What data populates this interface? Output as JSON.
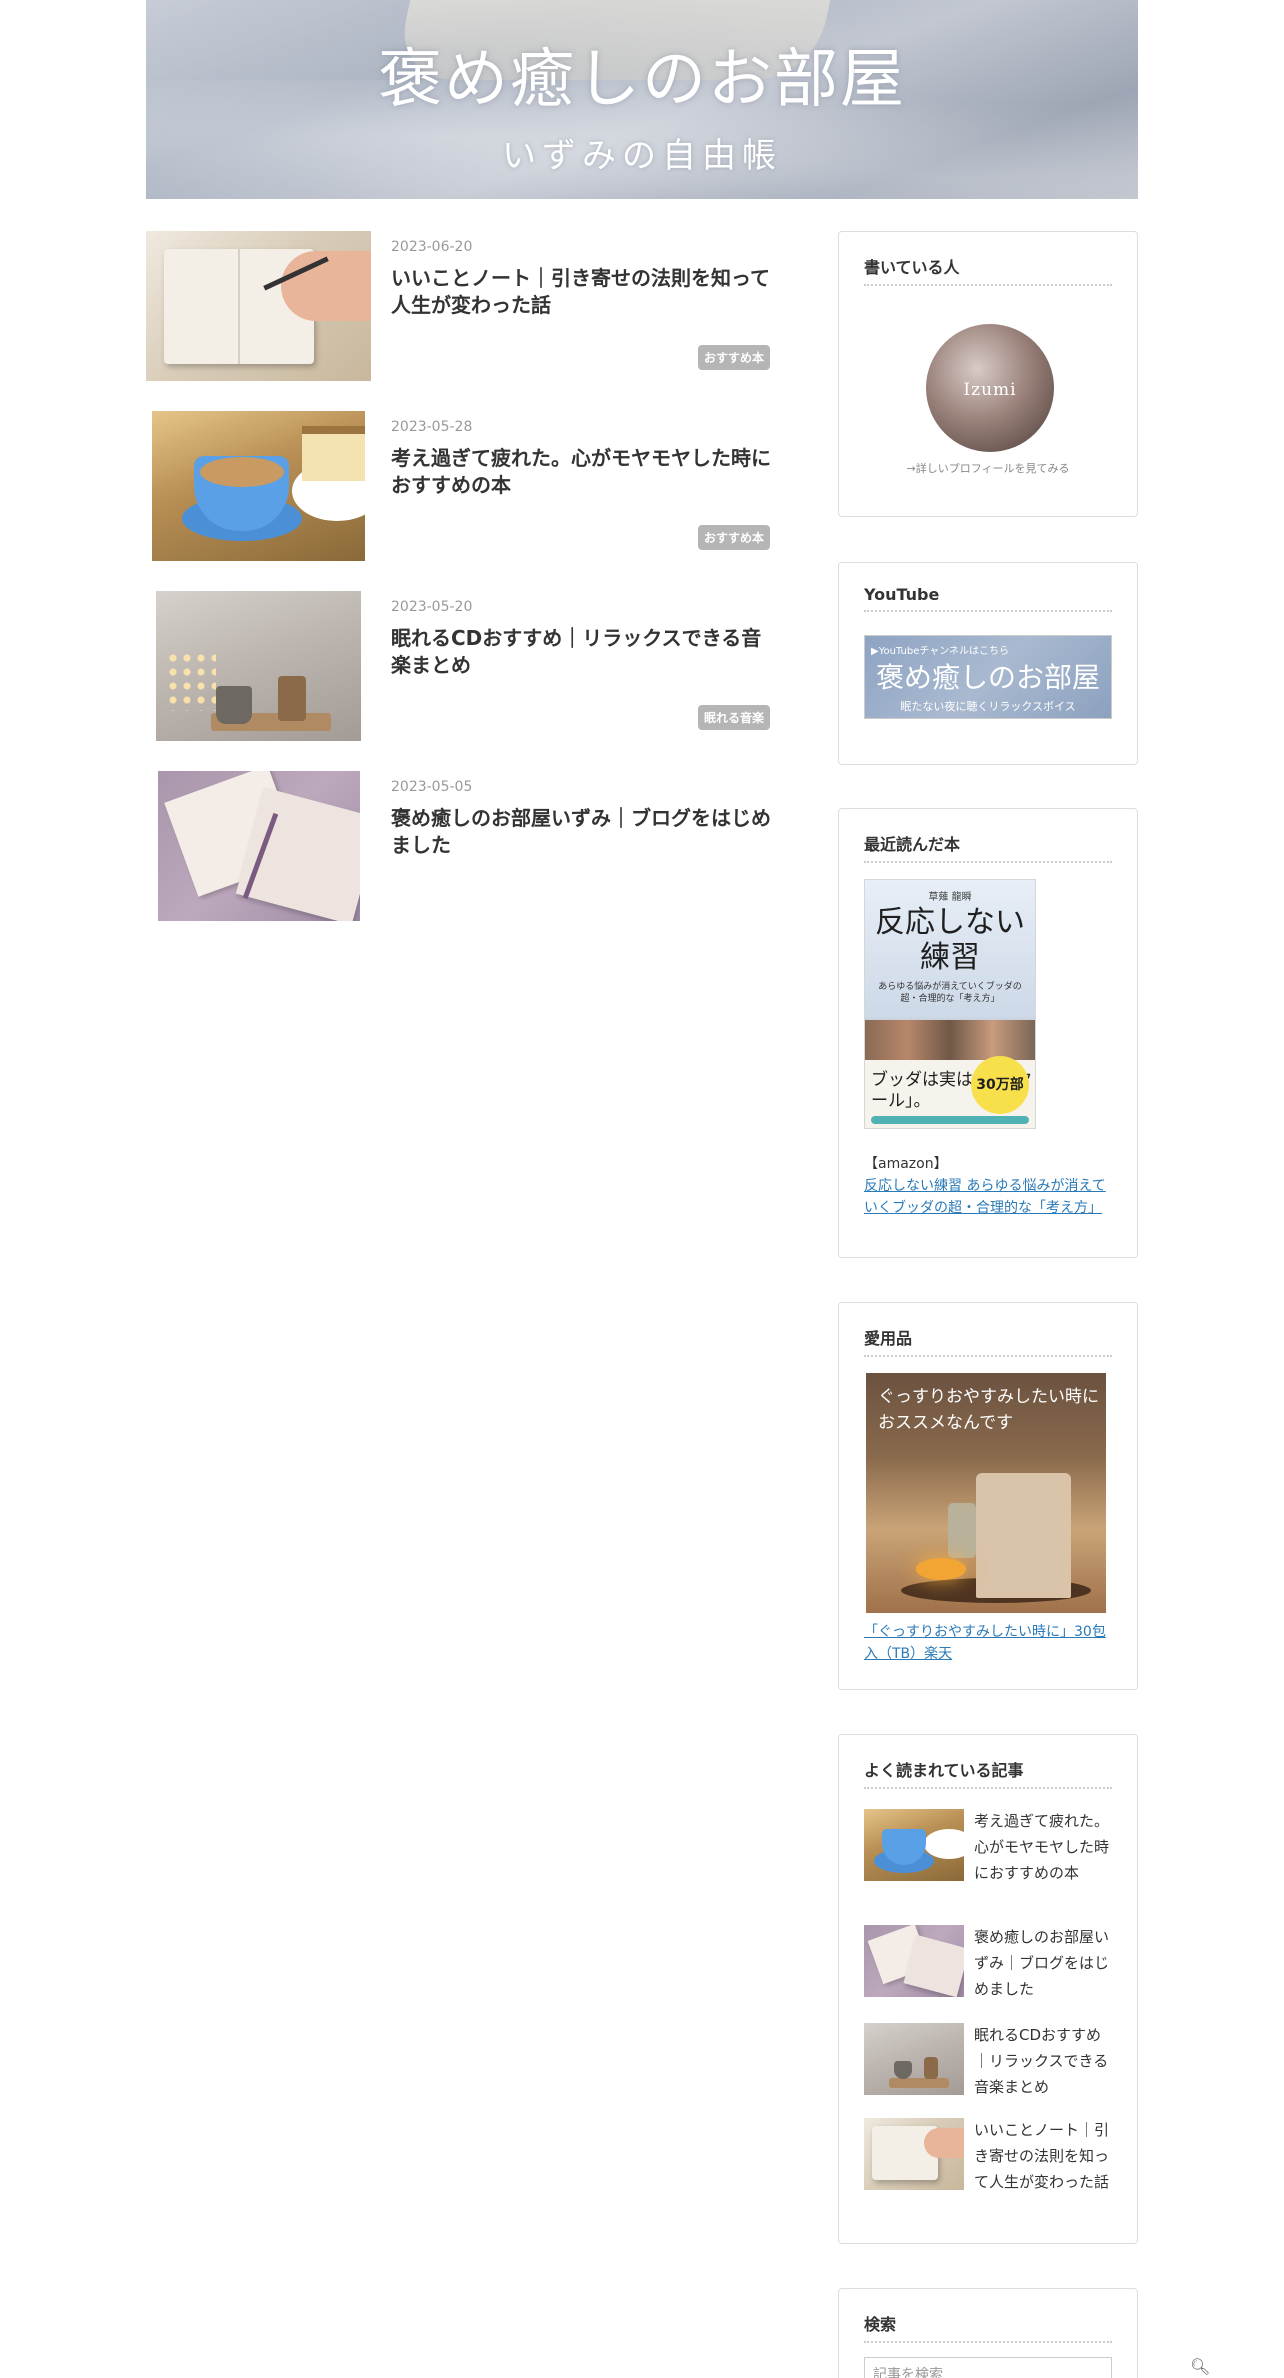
{
  "header": {
    "site_title": "褒め癒しのお部屋",
    "site_subtitle": "いずみの自由帳"
  },
  "articles": [
    {
      "date": "2023-06-20",
      "title": "いいことノート｜引き寄せの法則を知って人生が変わった話",
      "tag": "おすすめ本"
    },
    {
      "date": "2023-05-28",
      "title": "考え過ぎて疲れた。心がモヤモヤした時におすすめの本",
      "tag": "おすすめ本"
    },
    {
      "date": "2023-05-20",
      "title": "眠れるCDおすすめ｜リラックスできる音楽まとめ",
      "tag": "眠れる音楽"
    },
    {
      "date": "2023-05-05",
      "title": "褒め癒しのお部屋いずみ｜ブログをはじめました",
      "tag": ""
    }
  ],
  "sidebar": {
    "author": {
      "title": "書いている人",
      "avatar_name": "Izumi",
      "profile_link": "→詳しいプロフィールを見てみる"
    },
    "youtube": {
      "title": "YouTube",
      "banner_top": "▶YouTubeチャンネルはこちら",
      "banner_name": "褒め癒しのお部屋",
      "banner_bottom": "眠たない夜に聴くリラックスボイス"
    },
    "recent_book": {
      "title": "最近読んだ本",
      "cover_author": "草薙 龍瞬",
      "cover_title": "反応しない練習",
      "cover_subtitle": "あらゆる悩みが消えていくブッダの超・合理的な「考え方」",
      "cover_slogan": "ブッダは実は、「超クール」。",
      "cover_badge": "30万部",
      "amazon_label": "【amazon】",
      "amazon_link": "反応しない練習 あらゆる悩みが消えていくブッダの超・合理的な「考え方」"
    },
    "favorites": {
      "title": "愛用品",
      "photo_copy": "ぐっすりおやすみしたい時におススメなんです",
      "link": "「ぐっすりおやすみしたい時に」30包入（TB）楽天"
    },
    "popular": {
      "title": "よく読まれている記事",
      "items": [
        {
          "title": "考え過ぎて疲れた。心がモヤモヤした時におすすめの本"
        },
        {
          "title": "褒め癒しのお部屋いずみ｜ブログをはじめました"
        },
        {
          "title": "眠れるCDおすすめ｜リラックスできる音楽まとめ"
        },
        {
          "title": "いいことノート｜引き寄せの法則を知って人生が変わった話"
        }
      ]
    },
    "search": {
      "title": "検索",
      "placeholder": "記事を検索"
    }
  },
  "icons": {
    "search": "search-icon"
  },
  "colors": {
    "link": "#2a7ab8",
    "tag_bg": "#b5b5b5",
    "date": "#9a9a9a"
  }
}
